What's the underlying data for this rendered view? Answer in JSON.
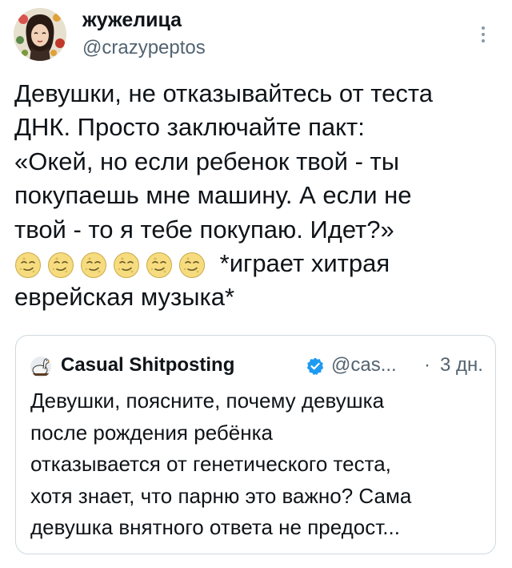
{
  "post": {
    "author": {
      "display_name": "жужелица",
      "handle": "@crazypeptos",
      "avatar_icon": "illustrated-woman-avatar"
    },
    "menu_icon": "more-vertical-icon",
    "text_lines": [
      "Девушки, не отказывайтесь от теста",
      "ДНК. Просто заключайте пакт:",
      "«Окей, но если ребенок твой - ты",
      "покупаешь мне машину. А если не",
      "твой - то я тебе покупаю. Идет?»"
    ],
    "emoji": {
      "name": "smirking-moon-face-emoji",
      "count": 6
    },
    "text_after_emoji": "*играет хитрая",
    "text_last_line": "еврейская музыка*"
  },
  "quote": {
    "author": {
      "display_name": "Casual Shitposting",
      "handle": "@cas...",
      "avatar_icon": "goose-avatar",
      "verified_icon": "verified-badge-icon"
    },
    "separator": "·",
    "time": "3 дн.",
    "text_lines": [
      "Девушки, поясните, почему девушка",
      "после рождения ребёнка",
      "отказывается от генетического теста,",
      "хотя знает, что парню это важно? Сама",
      "девушка внятного ответа не предост..."
    ]
  },
  "colors": {
    "text": "#0f1419",
    "secondary_text": "#536471",
    "border": "#cfd9de",
    "verified": "#1d9bf0"
  }
}
